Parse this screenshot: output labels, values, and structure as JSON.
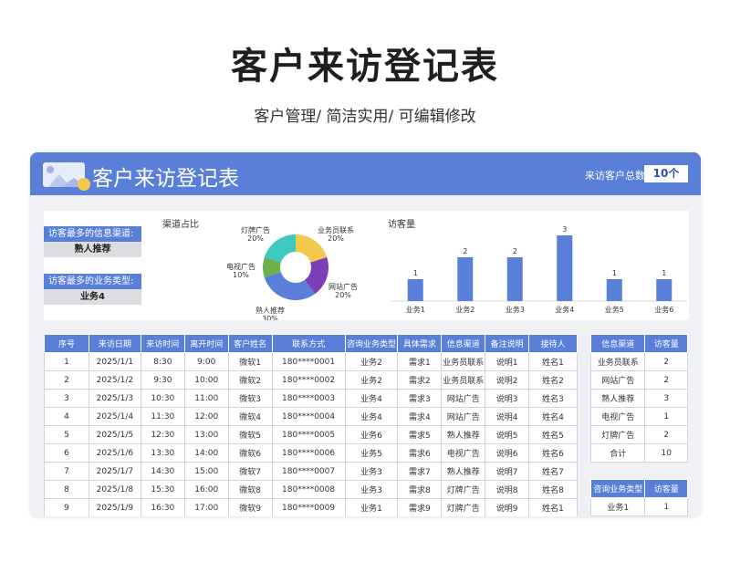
{
  "page": {
    "title": "客户来访登记表",
    "subtitle": "客户管理/ 简洁实用/ 可编辑修改"
  },
  "header": {
    "title": "客户来访登记表",
    "total_label": "来访客户总数",
    "total_value": "10个"
  },
  "stats": {
    "top_channel_label": "访客最多的信息渠道:",
    "top_channel_value": "熟人推荐",
    "top_business_label": "访客最多的业务类型:",
    "top_business_value": "业务4"
  },
  "colors": {
    "accent": "#5a7fd9",
    "donut": [
      "#f2c94c",
      "#7b3fb6",
      "#5a7fd9",
      "#6ab04c",
      "#3ec9c0"
    ]
  },
  "chart_data": [
    {
      "type": "pie",
      "title": "渠道占比",
      "categories": [
        "业务员联系",
        "网站广告",
        "熟人推荐",
        "电视广告",
        "灯牌广告"
      ],
      "values": [
        20,
        20,
        30,
        10,
        20
      ],
      "labels": [
        "20%",
        "20%",
        "30%",
        "10%",
        "20%"
      ]
    },
    {
      "type": "bar",
      "title": "访客量",
      "categories": [
        "业务1",
        "业务2",
        "业务3",
        "业务4",
        "业务5",
        "业务6"
      ],
      "values": [
        1,
        2,
        2,
        3,
        1,
        1
      ],
      "ylim": [
        0,
        3
      ]
    }
  ],
  "main_table": {
    "headers": [
      "序号",
      "来访日期",
      "来访时间",
      "离开时间",
      "客户姓名",
      "联系方式",
      "咨询业务类型",
      "具体需求",
      "信息渠道",
      "备注说明",
      "接待人"
    ],
    "rows": [
      [
        "1",
        "2025/1/1",
        "8:30",
        "9:00",
        "微软1",
        "180****0001",
        "业务2",
        "需求1",
        "业务员联系",
        "说明1",
        "姓名1"
      ],
      [
        "2",
        "2025/1/2",
        "9:30",
        "10:00",
        "微软2",
        "180****0002",
        "业务2",
        "需求2",
        "业务员联系",
        "说明2",
        "姓名2"
      ],
      [
        "3",
        "2025/1/3",
        "10:30",
        "11:00",
        "微软3",
        "180****0003",
        "业务4",
        "需求3",
        "网站广告",
        "说明3",
        "姓名3"
      ],
      [
        "4",
        "2025/1/4",
        "11:30",
        "12:00",
        "微软4",
        "180****0004",
        "业务4",
        "需求4",
        "网站广告",
        "说明4",
        "姓名4"
      ],
      [
        "5",
        "2025/1/5",
        "12:30",
        "13:00",
        "微软5",
        "180****0005",
        "业务6",
        "需求5",
        "熟人推荐",
        "说明5",
        "姓名5"
      ],
      [
        "6",
        "2025/1/6",
        "13:30",
        "14:00",
        "微软6",
        "180****0006",
        "业务5",
        "需求6",
        "电视广告",
        "说明6",
        "姓名6"
      ],
      [
        "7",
        "2025/1/7",
        "14:30",
        "15:00",
        "微软7",
        "180****0007",
        "业务3",
        "需求7",
        "熟人推荐",
        "说明7",
        "姓名7"
      ],
      [
        "8",
        "2025/1/8",
        "15:30",
        "16:00",
        "微软8",
        "180****0008",
        "业务3",
        "需求8",
        "灯牌广告",
        "说明8",
        "姓名8"
      ],
      [
        "9",
        "2025/1/9",
        "16:30",
        "17:00",
        "微软9",
        "180****0009",
        "业务1",
        "需求9",
        "灯牌广告",
        "说明9",
        "姓名1"
      ]
    ]
  },
  "channel_table": {
    "headers": [
      "信息渠道",
      "访客量"
    ],
    "rows": [
      [
        "业务员联系",
        "2"
      ],
      [
        "网站广告",
        "2"
      ],
      [
        "熟人推荐",
        "3"
      ],
      [
        "电视广告",
        "1"
      ],
      [
        "灯牌广告",
        "2"
      ],
      [
        "合计",
        "10"
      ]
    ]
  },
  "business_table": {
    "headers": [
      "咨询业务类型",
      "访客量"
    ],
    "rows": [
      [
        "业务1",
        "1"
      ]
    ]
  }
}
